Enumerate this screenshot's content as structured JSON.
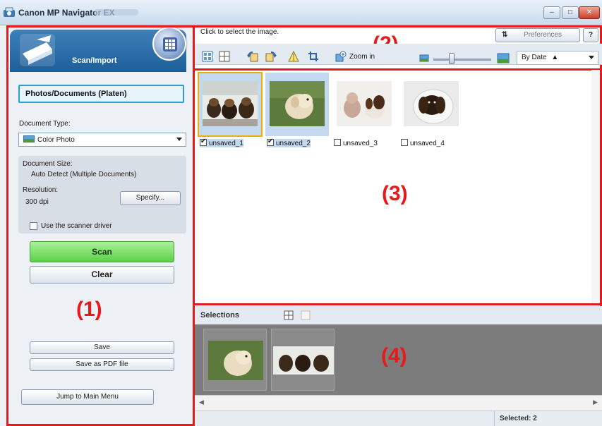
{
  "window": {
    "title": "Canon MP Navigator EX",
    "controls": [
      "minimize",
      "maximize",
      "close"
    ]
  },
  "left_panel": {
    "header_label": "Scan/Import",
    "mode_label": "Photos/Documents (Platen)",
    "document_type_label": "Document Type:",
    "document_type_value": "Color Photo",
    "document_size_label": "Document Size:",
    "document_size_value": "Auto Detect (Multiple Documents)",
    "resolution_label": "Resolution:",
    "resolution_value": "300 dpi",
    "specify_label": "Specify...",
    "use_driver_label": "Use the scanner driver",
    "use_driver_checked": false,
    "scan_label": "Scan",
    "clear_label": "Clear",
    "save_label": "Save",
    "save_pdf_label": "Save as PDF file",
    "jump_label": "Jump to Main Menu"
  },
  "toolbar": {
    "hint": "Click to select the image.",
    "preferences_label": "Preferences",
    "help_label": "?",
    "zoom_in_label": "Zoom in",
    "sort_value": "By Date",
    "icons": [
      "select-all-icon",
      "grid-view-icon",
      "rotate-left-icon",
      "rotate-right-icon",
      "correct-image-icon",
      "crop-icon",
      "zoom-in-icon"
    ]
  },
  "thumbnails": [
    {
      "name": "unsaved_1",
      "checked": true,
      "selected": true
    },
    {
      "name": "unsaved_2",
      "checked": true,
      "selected": true
    },
    {
      "name": "unsaved_3",
      "checked": false,
      "selected": false
    },
    {
      "name": "unsaved_4",
      "checked": false,
      "selected": false
    }
  ],
  "selections": {
    "label": "Selections",
    "count": 2
  },
  "status": {
    "selected_text": "Selected: 2"
  },
  "region_labels": {
    "r1": "(1)",
    "r2": "(2)",
    "r3": "(3)",
    "r4": "(4)"
  },
  "colors": {
    "region_border": "#e51b1b",
    "scan_button": "#5cd048",
    "header_blue": "#1e5f9a",
    "selection_bg": "#7c7c7c"
  }
}
